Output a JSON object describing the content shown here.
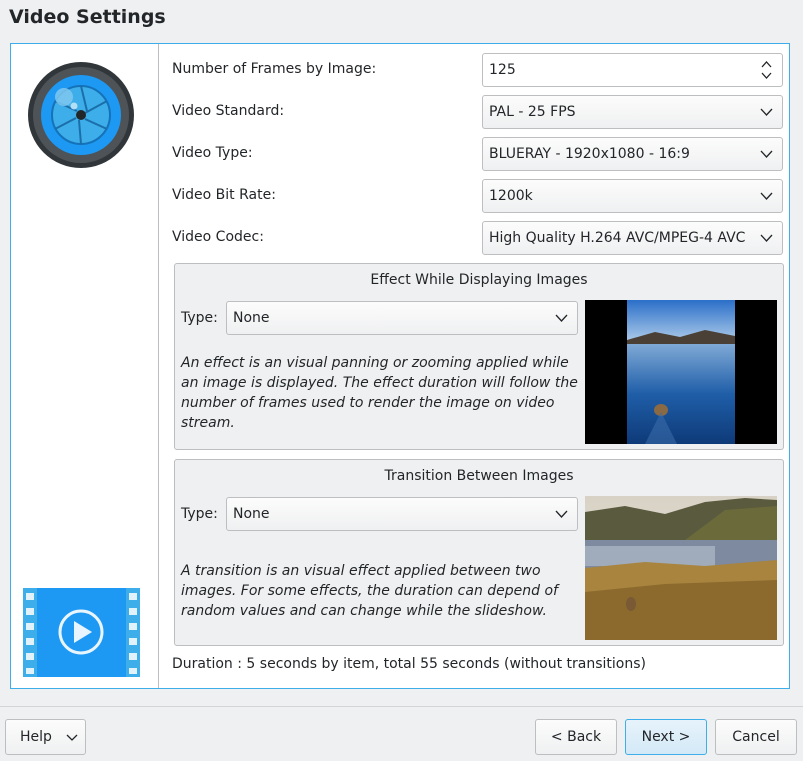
{
  "page": {
    "title": "Video Settings"
  },
  "sidebar": {
    "logo_icon": "camera-lens-icon",
    "bottom_icon": "video-film-icon"
  },
  "form": {
    "frames": {
      "label": "Number of Frames by Image:",
      "value": "125"
    },
    "standard": {
      "label": "Video Standard:",
      "value": "PAL - 25 FPS"
    },
    "type": {
      "label": "Video Type:",
      "value": "BLUERAY - 1920x1080 - 16:9"
    },
    "bitrate": {
      "label": "Video Bit Rate:",
      "value": "1200k"
    },
    "codec": {
      "label": "Video Codec:",
      "value": "High Quality H.264 AVC/MPEG-4 AVC"
    }
  },
  "effect": {
    "title": "Effect While Displaying Images",
    "type_label": "Type:",
    "type_value": "None",
    "description": "An effect is an visual panning or zooming applied while an image is displayed. The effect duration will follow the number of frames used to render the image on video stream."
  },
  "transition": {
    "title": "Transition Between Images",
    "type_label": "Type:",
    "type_value": "None",
    "description": "A transition is an visual effect applied between two images. For some effects, the duration can depend of random values and can change while the slideshow."
  },
  "duration_text": "Duration : 5 seconds by item, total 55 seconds (without transitions)",
  "buttons": {
    "help": "Help",
    "back": "< Back",
    "next": "Next >",
    "cancel": "Cancel"
  },
  "colors": {
    "accent": "#3daee9",
    "background": "#eff0f1"
  }
}
